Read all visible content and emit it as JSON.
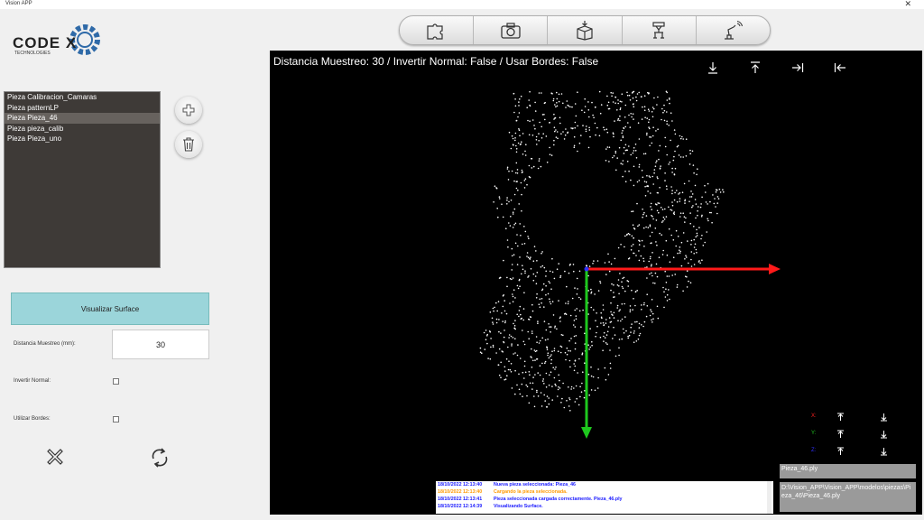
{
  "window": {
    "title": "Vision APP",
    "close_glyph": "✕"
  },
  "logo": {
    "main_text": "CODE X",
    "sub_text": "TECHNOLOGIES"
  },
  "toolbar": {
    "buttons": [
      "puzzle-icon",
      "camera-icon",
      "box-icon",
      "robot-gripper-icon",
      "robot-arm-signal-icon"
    ]
  },
  "piece_list": {
    "items": [
      "Pieza Calibracion_Camaras",
      "Pieza patternLP",
      "Pieza Pieza_46",
      "Pieza pieza_calib",
      "Pieza Pieza_uno"
    ],
    "selected_index": 2
  },
  "side_buttons": [
    "add-icon",
    "trash-icon"
  ],
  "controls": {
    "visualize_label": "Visualizar Surface",
    "distance_label": "Distancia Muestreo (mm):",
    "distance_value": "30",
    "invert_label": "Invertir Normal:",
    "invert_checked": false,
    "borders_label": "Utilizar Bordes:",
    "borders_checked": false
  },
  "bottom_icons": [
    "close-cross-icon",
    "refresh-icon"
  ],
  "viewer": {
    "header": "Distancia Muestreo: 30   /   Invertir Normal: False   /   Usar Bordes: False",
    "icons": [
      "download-icon",
      "upload-icon",
      "arrow-right-bar-icon",
      "arrow-left-bar-icon"
    ],
    "axes": [
      {
        "label": "X:",
        "color": "#ff2020"
      },
      {
        "label": "Y:",
        "color": "#20c020"
      },
      {
        "label": "Z:",
        "color": "#3030ff"
      }
    ],
    "axis_colors": {
      "x": "#ff1a1a",
      "y": "#1ec81e",
      "origin": "#3030ff"
    }
  },
  "log": [
    {
      "time": "18/10/2022 12:13:40",
      "msg": "Nueva pieza seleccionada: Pieza_46",
      "color": "#1a1aff"
    },
    {
      "time": "18/10/2022 12:13:40",
      "msg": "Cargando la pieza seleccionada.",
      "color": "#ff9900"
    },
    {
      "time": "18/10/2022 12:13:41",
      "msg": "Pieza seleccionada cargada correctamente. Pieza_46.ply",
      "color": "#1a1aff"
    },
    {
      "time": "18/10/2022 12:14:39",
      "msg": "Visualizando Surface.",
      "color": "#1a1aff"
    }
  ],
  "file": {
    "name": "Pieza_46.ply",
    "path": "D:\\Vision_APP\\Vision_APP\\modelos\\piezas\\Pieza_46\\Pieza_46.ply"
  }
}
